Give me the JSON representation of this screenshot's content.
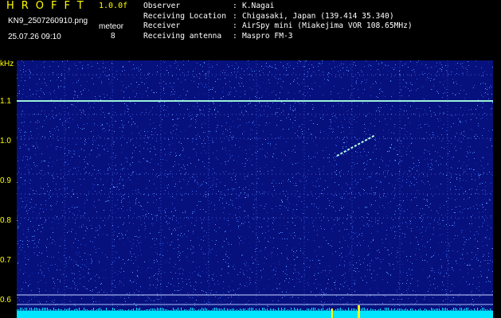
{
  "header": {
    "app_title": "HROFFT",
    "version": "1.0.0f",
    "filename": "KN9_2507260910.png",
    "mode": "meteor",
    "datetime": "25.07.26 09:10",
    "count": "8"
  },
  "meta": [
    {
      "key": "Observer",
      "sep": ":",
      "value": "K.Nagai"
    },
    {
      "key": "Receiving Location",
      "sep": ":",
      "value": "Chigasaki, Japan (139.414 35.340)"
    },
    {
      "key": "Receiver",
      "sep": ":",
      "value": "AirSpy mini (Miakejima VOR 108.65MHz)"
    },
    {
      "key": "Receiving antenna",
      "sep": ":",
      "value": "Maspro FM-3"
    }
  ],
  "spectrogram": {
    "y_unit": "kHz",
    "y_labels": [
      "1.1",
      "1.0",
      "0.9",
      "0.8",
      "0.7",
      "0.6"
    ],
    "x_labels": [
      "0911",
      "0912",
      "0913",
      "0914",
      "0915",
      "0916",
      "0917",
      "0918",
      "0919",
      "0920"
    ],
    "colors": {
      "background": "#07117e",
      "axis_text": "#ffff00",
      "carrier": "#9cf0d8",
      "baseline": "#00e5ff",
      "meteor": "#b8ffe8"
    }
  }
}
